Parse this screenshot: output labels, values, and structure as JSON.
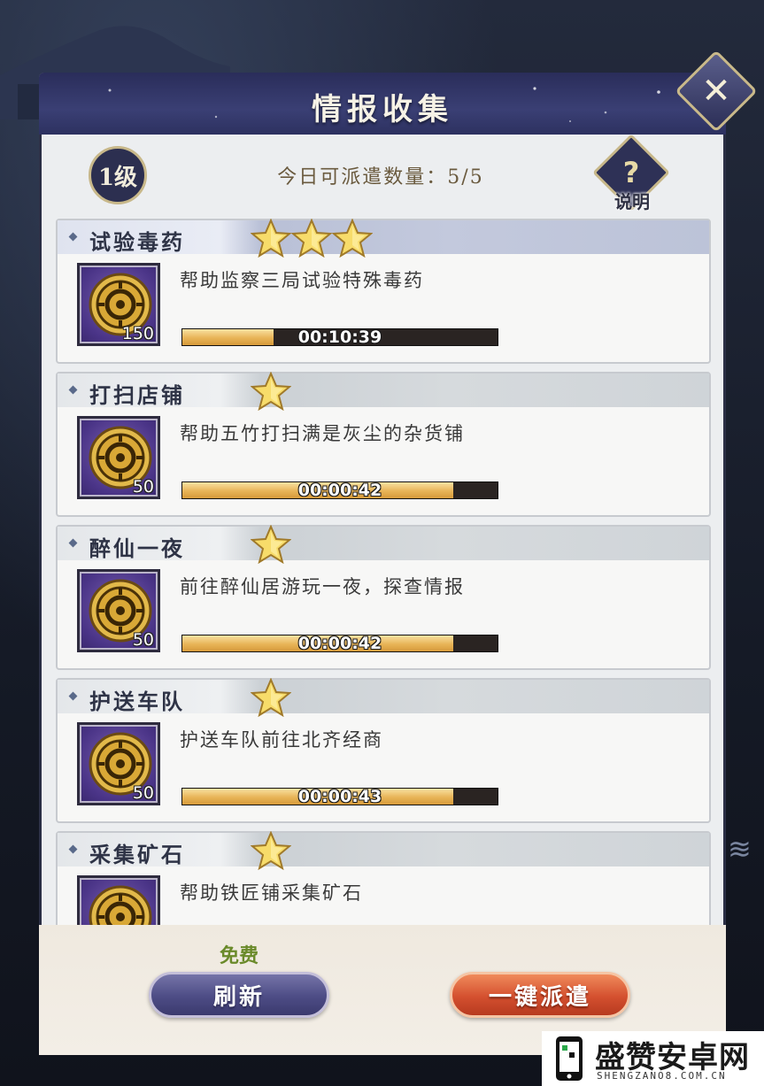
{
  "header": {
    "title": "情报收集"
  },
  "info": {
    "level": "1级",
    "dispatch_label": "今日可派遣数量：5/5",
    "help_icon": "question-icon",
    "help_label": "说明"
  },
  "tasks": [
    {
      "name": "试验毒药",
      "stars": 3,
      "desc": "帮助监察三局试验特殊毒药",
      "reward_count": "150",
      "timer": "00:10:39",
      "progress": 0.29
    },
    {
      "name": "打扫店铺",
      "stars": 1,
      "desc": "帮助五竹打扫满是灰尘的杂货铺",
      "reward_count": "50",
      "timer": "00:00:42",
      "progress": 0.86
    },
    {
      "name": "醉仙一夜",
      "stars": 1,
      "desc": "前往醉仙居游玩一夜，探查情报",
      "reward_count": "50",
      "timer": "00:00:42",
      "progress": 0.86
    },
    {
      "name": "护送车队",
      "stars": 1,
      "desc": "护送车队前往北齐经商",
      "reward_count": "50",
      "timer": "00:00:43",
      "progress": 0.86
    },
    {
      "name": "采集矿石",
      "stars": 1,
      "desc": "帮助铁匠铺采集矿石",
      "reward_count": "",
      "timer": "",
      "progress": 0
    }
  ],
  "footer": {
    "free_label": "免费",
    "refresh_label": "刷新",
    "dispatch_all_label": "一键派遣"
  },
  "watermark": {
    "text": "盛赞安卓网",
    "sub": "SHENGZANO8.COM.CN"
  },
  "colors": {
    "panel_header": "#2a2d5a",
    "progress_fill": "#e8b457",
    "refresh_btn": "#4d4c85",
    "dispatch_btn": "#d4502f"
  }
}
